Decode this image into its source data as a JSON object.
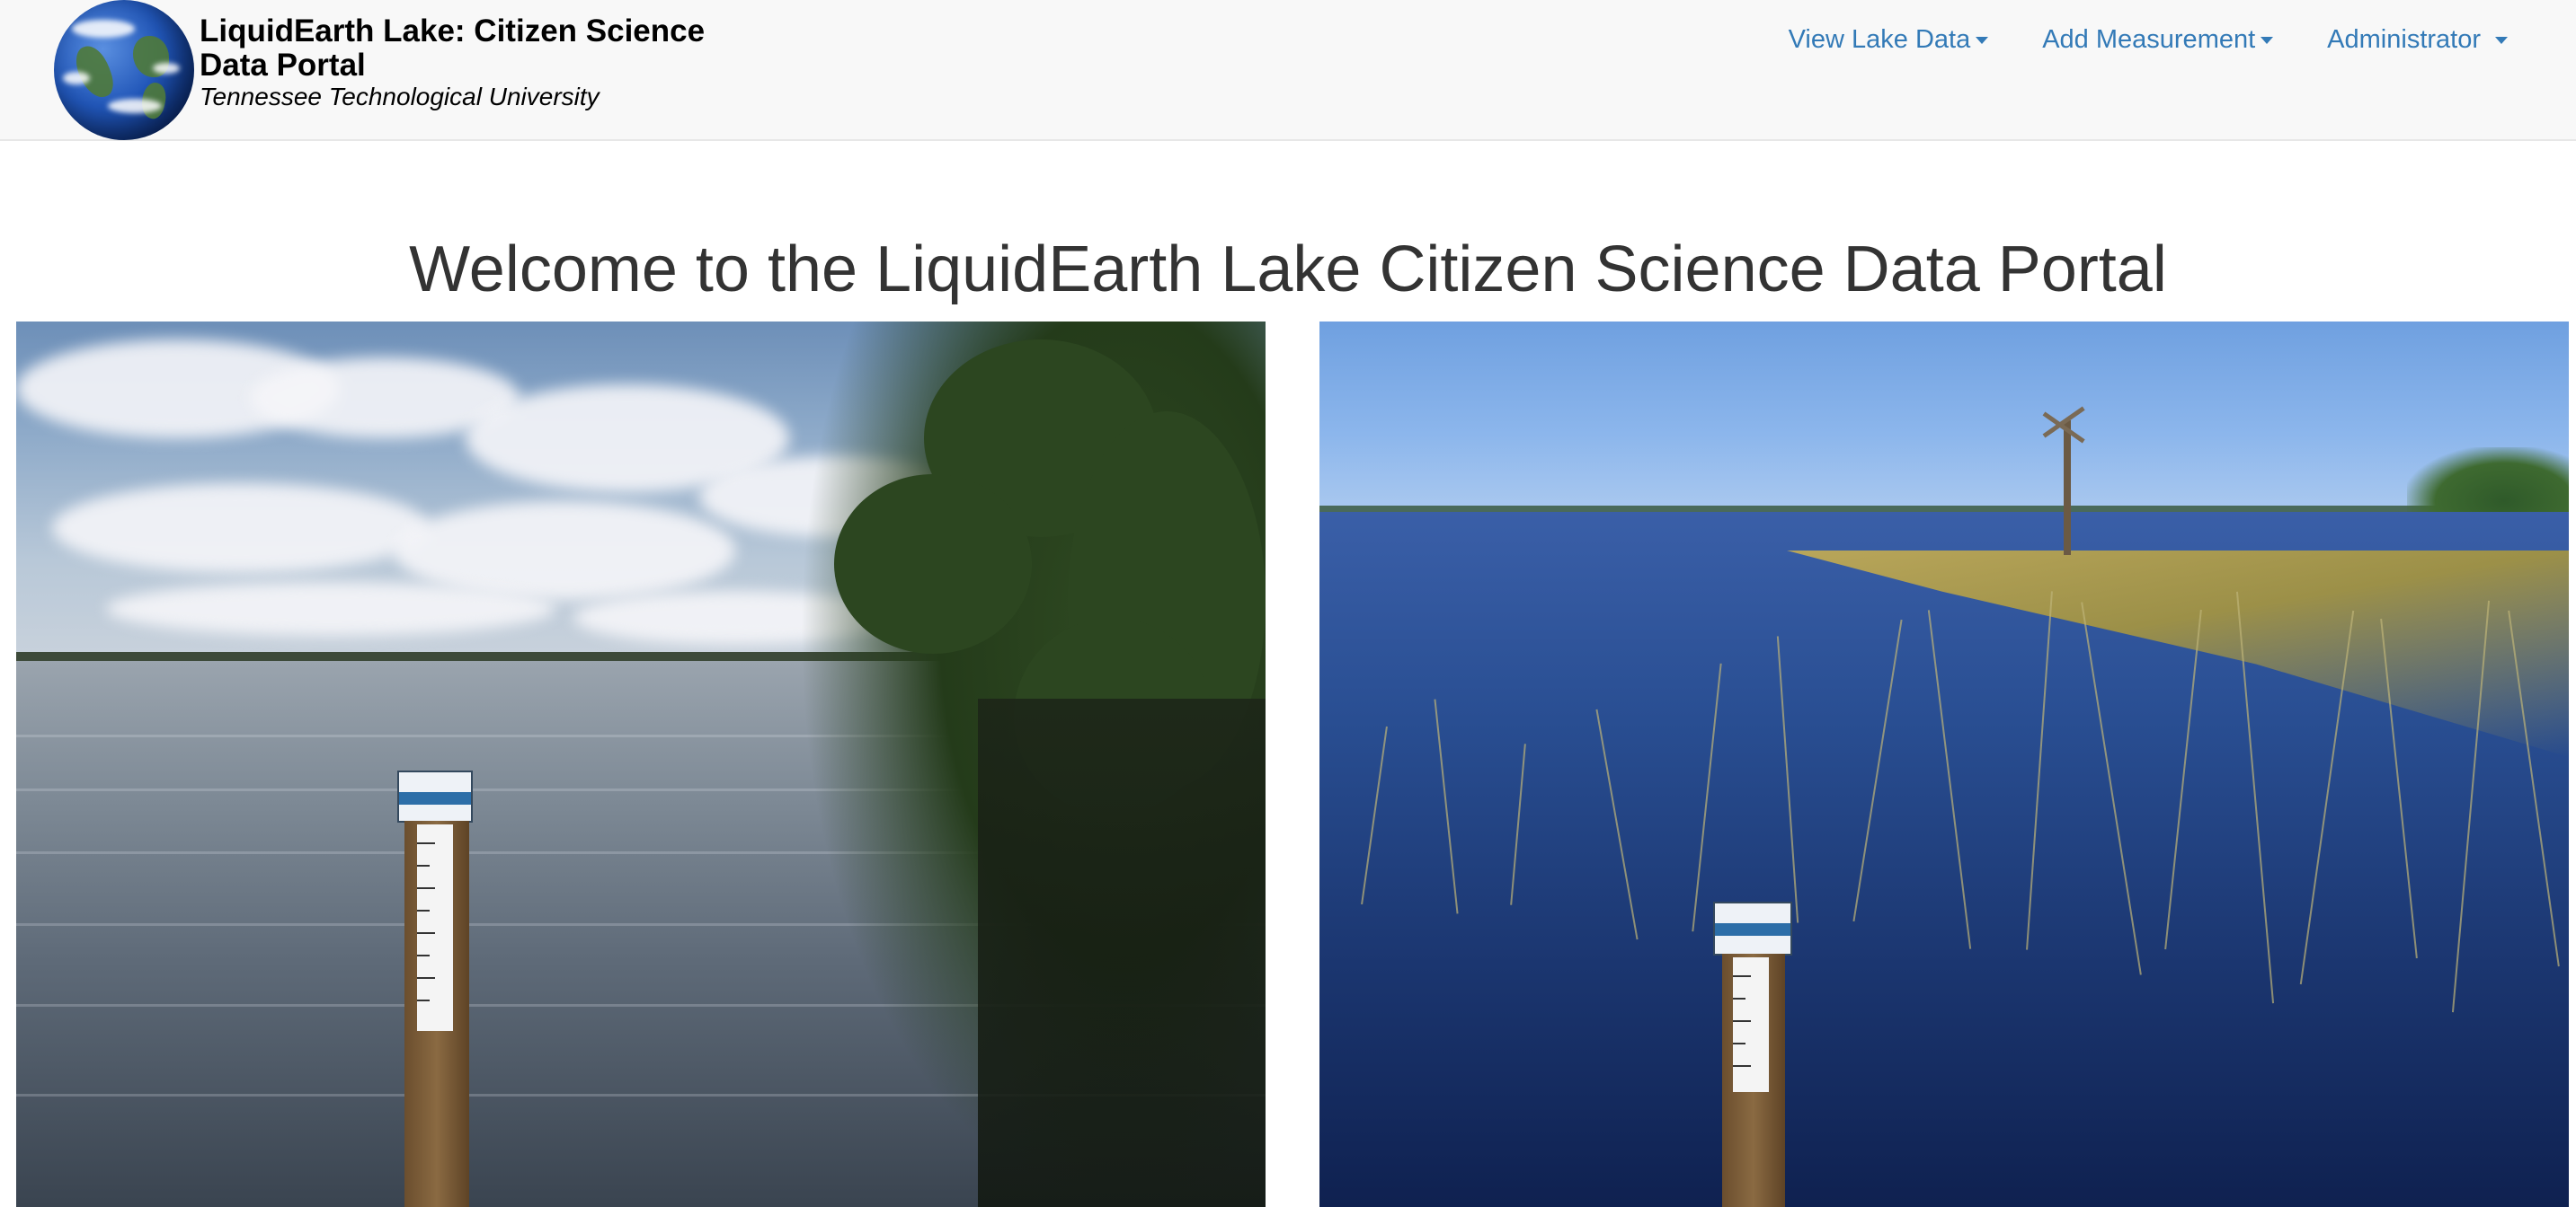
{
  "navbar": {
    "title": "LiquidEarth Lake: Citizen Science Data Portal",
    "subtitle": "Tennessee Technological University",
    "logo_icon": "globe-icon",
    "items": [
      {
        "label": "View Lake Data"
      },
      {
        "label": "Add Measurement"
      },
      {
        "label": "Administrator"
      }
    ],
    "link_color": "#337ab7"
  },
  "main": {
    "heading": "Welcome to the LiquidEarth Lake Citizen Science Data Portal"
  }
}
